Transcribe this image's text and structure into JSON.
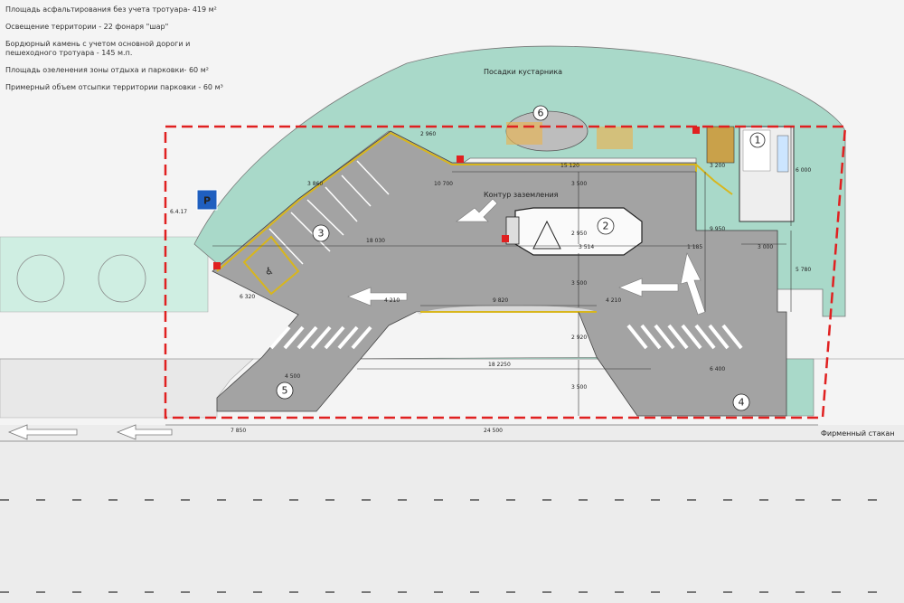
{
  "notes": [
    "Площадь асфальтирования без учета тротуара- 419 м²",
    "Освещение территории - 22 фонаря \"шар\"",
    "Бордюрный камень с учетом основной дороги и пешеходного тротуара - 145 м.п.",
    "Площадь озеленения зоны отдыха и парковки- 60 м²",
    "Примерный объем отсыпки территории парковки - 60 м³"
  ],
  "labels": {
    "shrubs": "Посадки кустарника",
    "grounding": "Контур заземления",
    "brand_glass": "Фирменный стакан",
    "sign_code": "6.4.17",
    "parking_sign": "P"
  },
  "zones": [
    "1",
    "2",
    "3",
    "4",
    "5",
    "6"
  ],
  "dimensions": {
    "d_15120": "15 120",
    "d_10700": "10 700",
    "d_18030": "18 030",
    "d_9820": "9 820",
    "d_4210a": "4 210",
    "d_4210b": "4 210",
    "d_18225": "18 2250",
    "d_24500": "24 500",
    "d_7850": "7 850",
    "d_3000": "3 000",
    "d_6000": "6 000",
    "d_5780": "5 780",
    "d_9950": "9 950",
    "d_3500a": "3 500",
    "d_3500b": "3 500",
    "d_2920": "2 920",
    "d_6400": "6 400",
    "d_4500": "4 500",
    "d_6320": "6 320",
    "d_3860": "3 860",
    "d_2960": "2 960",
    "d_3200": "3 200",
    "d_1185": "1 185",
    "d_2950": "2 950",
    "d_3514": "3 514",
    "d_3000b": "3 000"
  },
  "colors": {
    "asphalt": "#a3a3a3",
    "green": "#a9d9c9",
    "boundary": "#e02020",
    "curb": "#d8b61c"
  }
}
